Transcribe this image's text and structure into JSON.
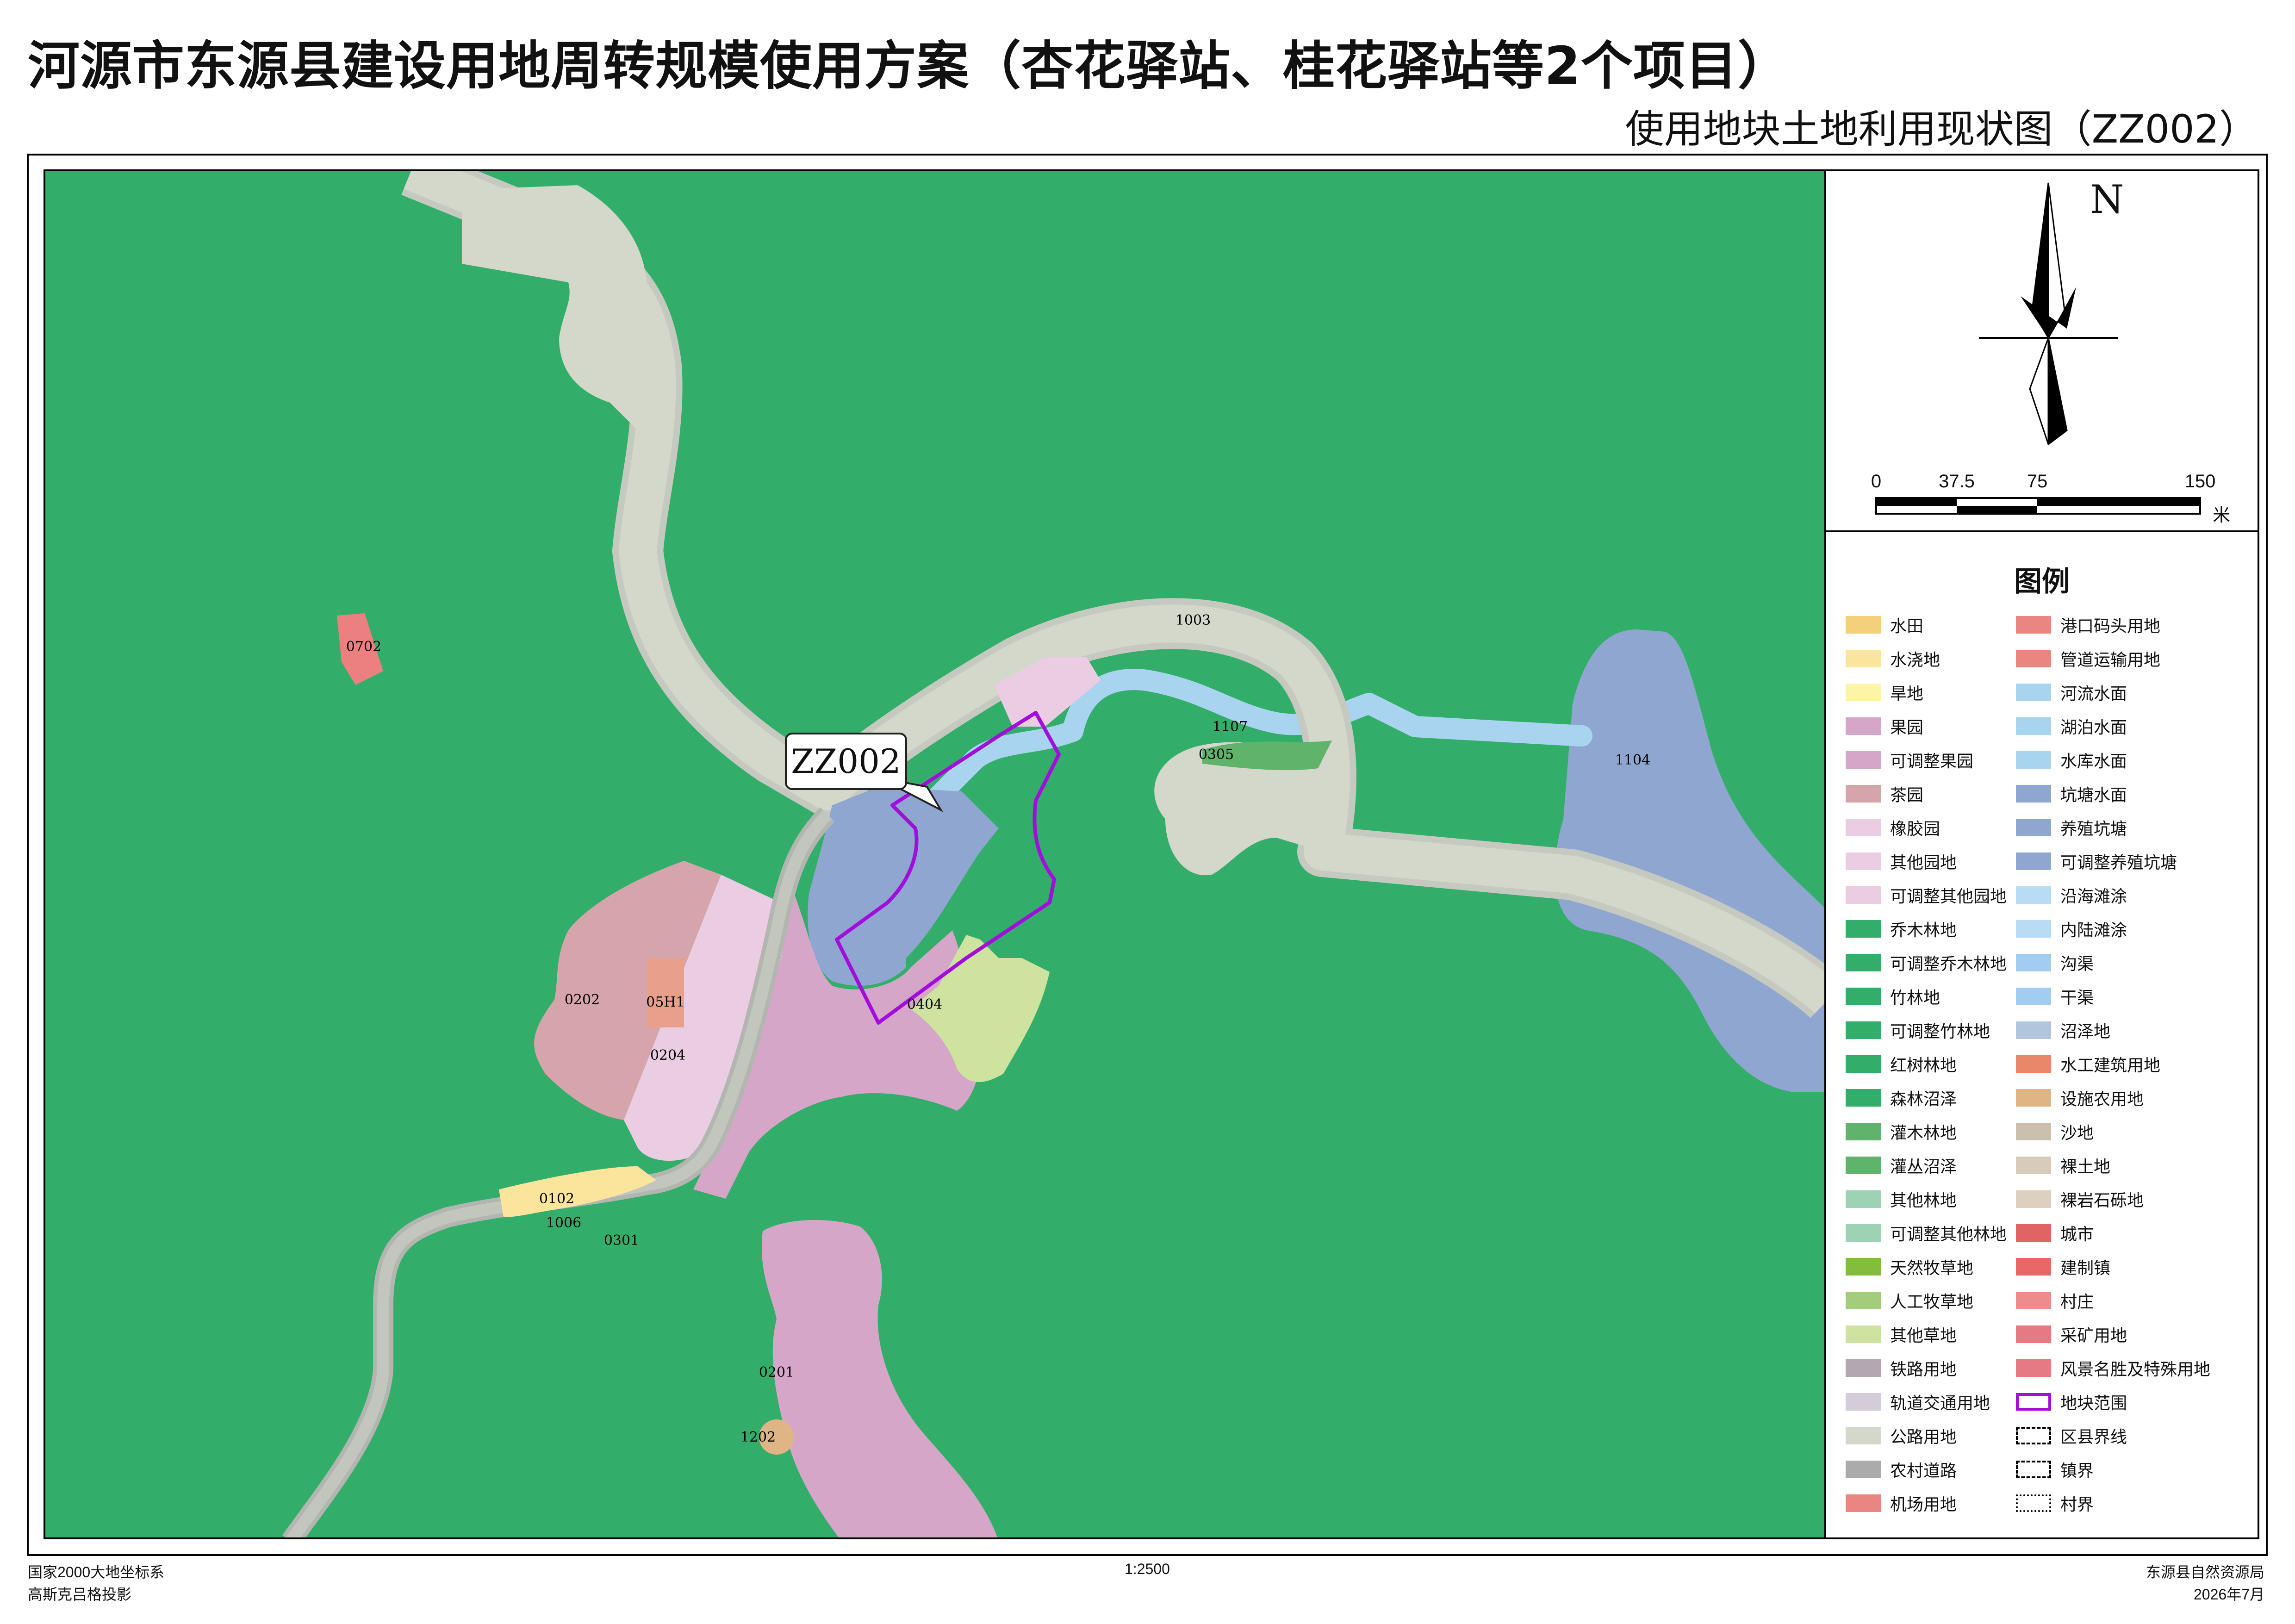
{
  "title": "河源市东源县建设用地周转规模使用方案（杏花驿站、桂花驿站等2个项目）",
  "subtitle": "使用地块土地利用现状图（ZZ002）",
  "north_label": "N",
  "scale": {
    "labels": [
      "0",
      "37.5",
      "75",
      "150"
    ],
    "unit": "米"
  },
  "parcel_callout": "ZZ002",
  "parcel_labels": {
    "p0702": "0702",
    "p1003": "1003",
    "p1107": "1107",
    "p0305": "0305",
    "p1104": "1104",
    "p0202": "0202",
    "p05H1": "05H1",
    "p0204": "0204",
    "p0404": "0404",
    "p0102": "0102",
    "p1006": "1006",
    "p0301": "0301",
    "p0201": "0201",
    "p1202": "1202"
  },
  "legend_title": "图例",
  "legend_left": [
    {
      "label": "水田",
      "color": "#f5d07a"
    },
    {
      "label": "水浇地",
      "color": "#fbe59b"
    },
    {
      "label": "旱地",
      "color": "#fdf4a8"
    },
    {
      "label": "果园",
      "color": "#d6a6c9"
    },
    {
      "label": "可调整果园",
      "color": "#d6a6c9"
    },
    {
      "label": "茶园",
      "color": "#d5a5ab"
    },
    {
      "label": "橡胶园",
      "color": "#ebcde3"
    },
    {
      "label": "其他园地",
      "color": "#ebcde3"
    },
    {
      "label": "可调整其他园地",
      "color": "#ebcde3"
    },
    {
      "label": "乔木林地",
      "color": "#33ad6a"
    },
    {
      "label": "可调整乔木林地",
      "color": "#33ad6a"
    },
    {
      "label": "竹林地",
      "color": "#33ad6a"
    },
    {
      "label": "可调整竹林地",
      "color": "#33ad6a"
    },
    {
      "label": "红树林地",
      "color": "#33ad6a"
    },
    {
      "label": "森林沼泽",
      "color": "#33ad6a"
    },
    {
      "label": "灌木林地",
      "color": "#5fb36a"
    },
    {
      "label": "灌丛沼泽",
      "color": "#5fb36a"
    },
    {
      "label": "其他林地",
      "color": "#9dd3b4"
    },
    {
      "label": "可调整其他林地",
      "color": "#9dd3b4"
    },
    {
      "label": "天然牧草地",
      "color": "#82bd3c"
    },
    {
      "label": "人工牧草地",
      "color": "#a3cd7b"
    },
    {
      "label": "其他草地",
      "color": "#cde39f"
    },
    {
      "label": "铁路用地",
      "color": "#b3a7b2"
    },
    {
      "label": "轨道交通用地",
      "color": "#d4ccd8"
    },
    {
      "label": "公路用地",
      "color": "#d4d8cb"
    },
    {
      "label": "农村道路",
      "color": "#ababab"
    },
    {
      "label": "机场用地",
      "color": "#e88781"
    }
  ],
  "legend_right": [
    {
      "label": "港口码头用地",
      "color": "#e88781"
    },
    {
      "label": "管道运输用地",
      "color": "#e88781"
    },
    {
      "label": "河流水面",
      "color": "#a8d4f0"
    },
    {
      "label": "湖泊水面",
      "color": "#a8d4f0"
    },
    {
      "label": "水库水面",
      "color": "#a8d4f0"
    },
    {
      "label": "坑塘水面",
      "color": "#8fa7d0"
    },
    {
      "label": "养殖坑塘",
      "color": "#8fa7d0"
    },
    {
      "label": "可调整养殖坑塘",
      "color": "#8fa7d0"
    },
    {
      "label": "沿海滩涂",
      "color": "#b9dcf5"
    },
    {
      "label": "内陆滩涂",
      "color": "#b9dcf5"
    },
    {
      "label": "沟渠",
      "color": "#a3cdf0"
    },
    {
      "label": "干渠",
      "color": "#a3cdf0"
    },
    {
      "label": "沼泽地",
      "color": "#b1c6dc"
    },
    {
      "label": "水工建筑用地",
      "color": "#e8876a"
    },
    {
      "label": "设施农用地",
      "color": "#e0b585"
    },
    {
      "label": "沙地",
      "color": "#cbbfae"
    },
    {
      "label": "裸土地",
      "color": "#d9cbba"
    },
    {
      "label": "裸岩石砾地",
      "color": "#ddd0c0"
    },
    {
      "label": "城市",
      "color": "#e06464"
    },
    {
      "label": "建制镇",
      "color": "#e86868"
    },
    {
      "label": "村庄",
      "color": "#ec8c8c"
    },
    {
      "label": "采矿用地",
      "color": "#e67a82"
    },
    {
      "label": "风景名胜及特殊用地",
      "color": "#e67a82"
    },
    {
      "label": "地块范围",
      "color": "#a30ddc",
      "style": "outline"
    },
    {
      "label": "区县界线",
      "color": "#000000",
      "style": "dash"
    },
    {
      "label": "镇界",
      "color": "#000000",
      "style": "dash"
    },
    {
      "label": "村界",
      "color": "#000000",
      "style": "dashdot"
    }
  ],
  "footer": {
    "crs": "国家2000大地坐标系",
    "projection": "高斯克吕格投影",
    "ratio": "1:2500",
    "agency": "东源县自然资源局",
    "date": "2026年7月"
  }
}
